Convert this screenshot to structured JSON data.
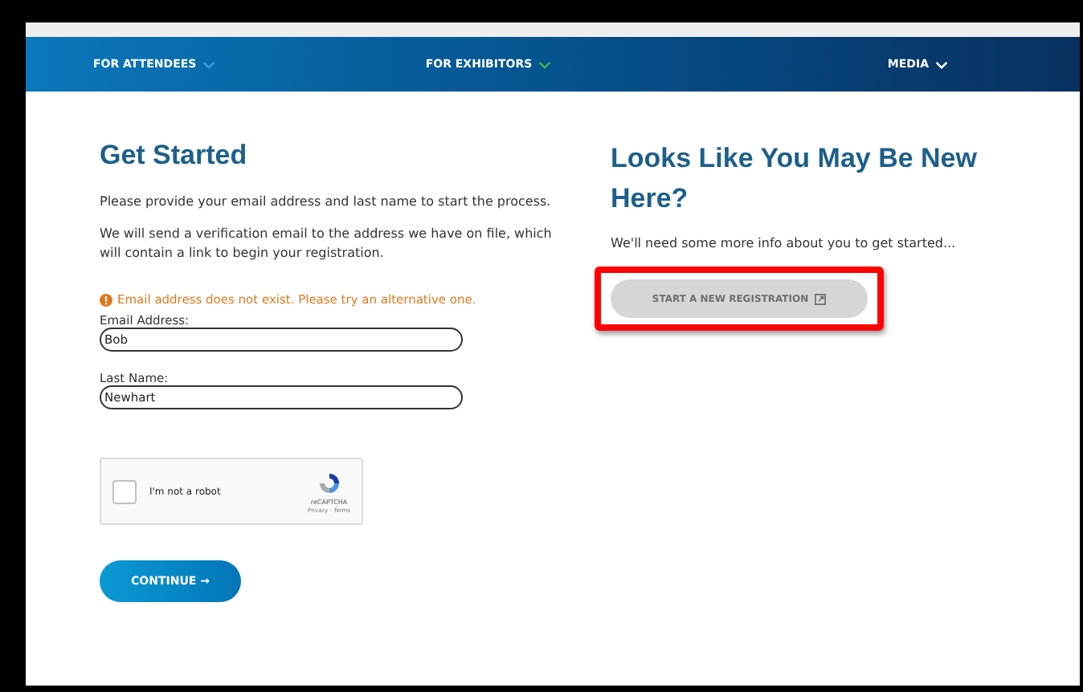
{
  "nav": {
    "items": [
      {
        "label": "FOR ATTENDEES",
        "selected": false
      },
      {
        "label": "FOR EXHIBITORS",
        "selected": false
      },
      {
        "label": "MEDIA",
        "selected": false
      }
    ]
  },
  "left": {
    "title": "Get Started",
    "paragraphs": [
      "Please provide your email address and last name to start the process.",
      "We will send a verification email to the address we have on file, which will contain a link to begin your registration."
    ],
    "error": "Email address does not exist. Please try an alternative one.",
    "fields": [
      {
        "label": "Email Address:",
        "value": "Bob"
      },
      {
        "label": "Last Name:",
        "value": "Newhart"
      }
    ],
    "captcha": {
      "label": "I'm not a robot",
      "checked": false,
      "brand": "reCAPTCHA",
      "links": "Privacy - Terms"
    },
    "button": {
      "label": "CONTINUE →"
    }
  },
  "right": {
    "title": "Looks Like You May Be New Here?",
    "text": "We'll need some more info about you to get started...",
    "button": {
      "label": "START A NEW REGISTRATION",
      "disabled": true,
      "highlighted": true
    }
  }
}
